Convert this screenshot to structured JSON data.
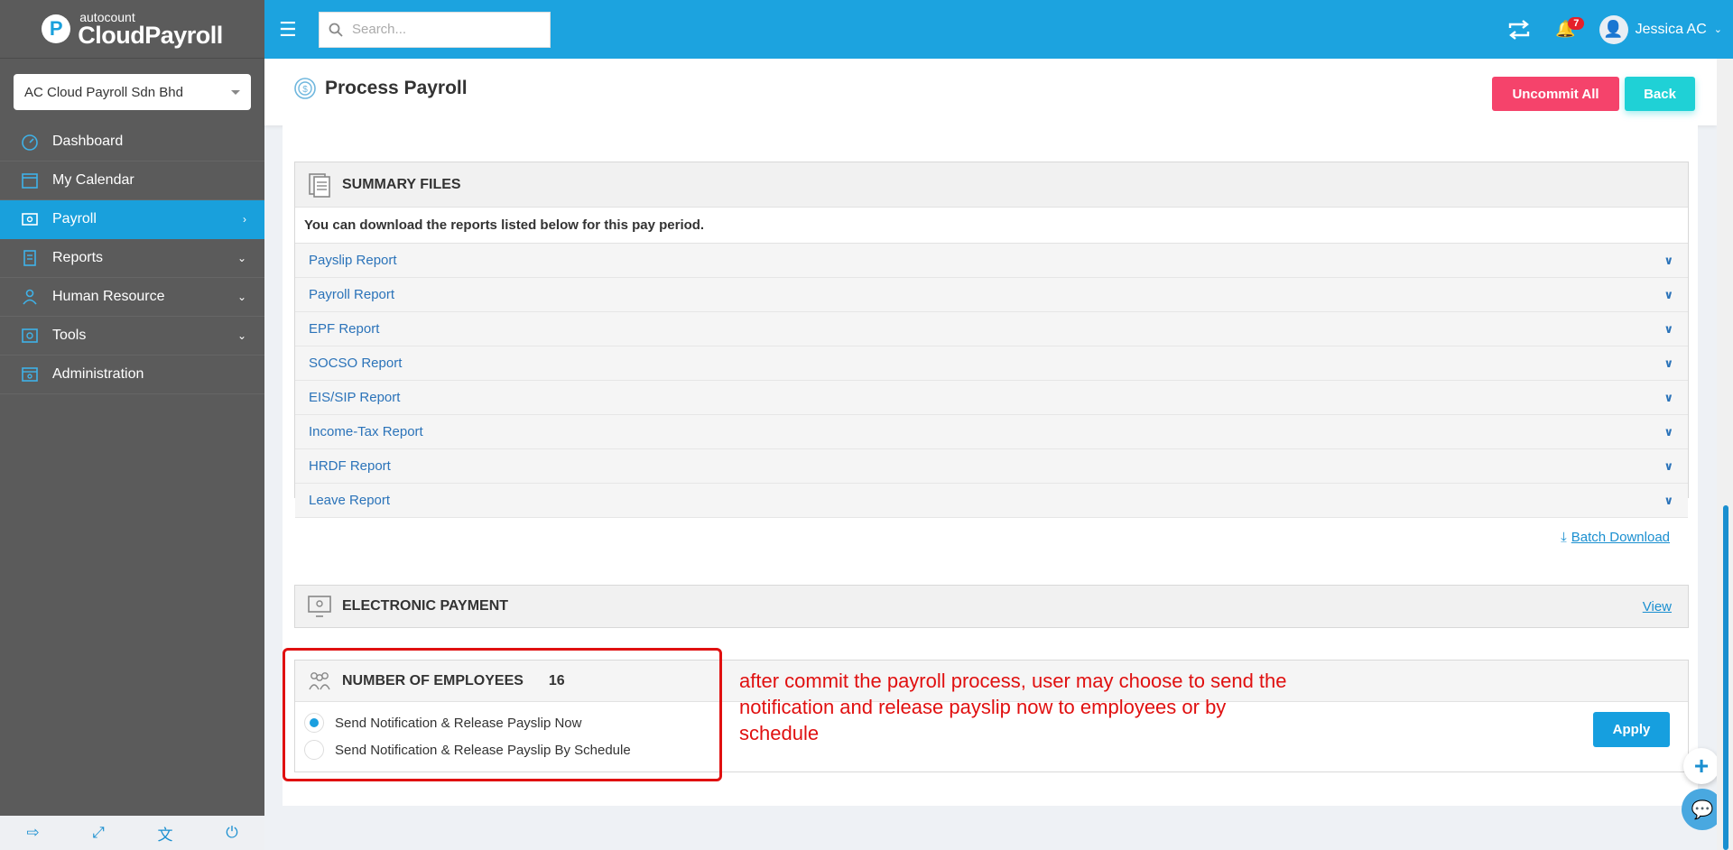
{
  "app": {
    "logo_small": "autocount",
    "logo_big": "CloudPayroll"
  },
  "sidebar": {
    "company": "AC Cloud Payroll Sdn Bhd",
    "items": [
      {
        "label": "Dashboard",
        "icon": "dashboard-icon",
        "arrow": ""
      },
      {
        "label": "My Calendar",
        "icon": "calendar-icon",
        "arrow": ""
      },
      {
        "label": "Payroll",
        "icon": "payroll-icon",
        "arrow": "›",
        "active": true
      },
      {
        "label": "Reports",
        "icon": "reports-icon",
        "arrow": "⌄"
      },
      {
        "label": "Human Resource",
        "icon": "human-resource-icon",
        "arrow": "⌄"
      },
      {
        "label": "Tools",
        "icon": "tools-icon",
        "arrow": "⌄"
      },
      {
        "label": "Administration",
        "icon": "administration-icon",
        "arrow": ""
      }
    ]
  },
  "topbar": {
    "search_placeholder": "Search...",
    "notification_count": "7",
    "user_name": "Jessica AC"
  },
  "page": {
    "title": "Process Payroll",
    "uncommit_label": "Uncommit All",
    "back_label": "Back"
  },
  "summary_files": {
    "title": "SUMMARY FILES",
    "description": "You can download the reports listed below for this pay period.",
    "reports": [
      "Payslip Report",
      "Payroll Report",
      "EPF Report",
      "SOCSO Report",
      "EIS/SIP Report",
      "Income-Tax Report",
      "HRDF Report",
      "Leave Report"
    ],
    "batch_download": "Batch Download"
  },
  "electronic_payment": {
    "title": "ELECTRONIC PAYMENT",
    "view_label": "View"
  },
  "employees": {
    "title": "NUMBER OF EMPLOYEES",
    "count": "16",
    "option_now": "Send Notification & Release Payslip Now",
    "option_schedule": "Send Notification & Release Payslip By Schedule",
    "selected": "now",
    "apply_label": "Apply"
  },
  "annotation": {
    "text": "after commit the payroll process, user may choose to send the notification and release payslip now to employees or by schedule"
  },
  "colors": {
    "accent": "#1ca3df",
    "sidebar": "#5b5b5b",
    "danger": "#f5436b",
    "teal": "#1fd1d6",
    "annotation": "#e01010"
  }
}
